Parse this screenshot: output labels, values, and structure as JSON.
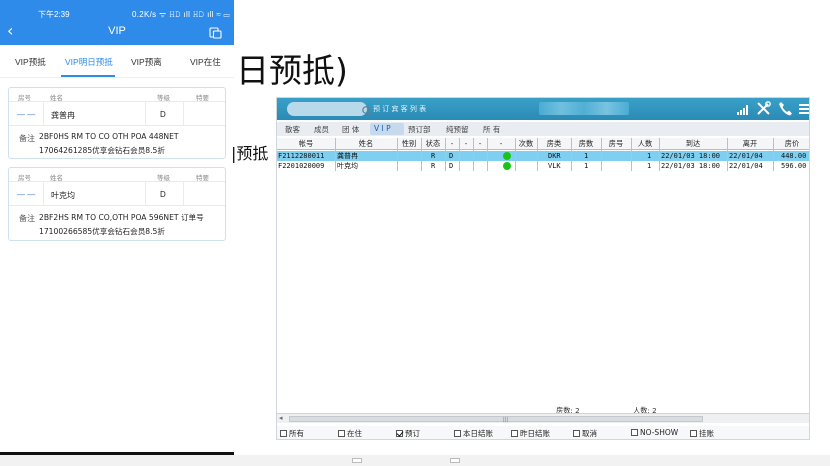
{
  "phone": {
    "status_time": "下午2:39",
    "status_right": "0.2K/s ᯤ 𝙷𝙳 ıll 𝙷𝙳 ıll ≈ ▭",
    "title": "VIP",
    "back_glyph": "‹",
    "tabs": [
      "VIP预抵",
      "VIP明日预抵",
      "VIP预离",
      "VIP在住"
    ],
    "active_tab": 1,
    "column_headers": {
      "room": "房号",
      "name": "姓名",
      "level": "等级",
      "special": "特要"
    },
    "note_label": "备注",
    "cards": [
      {
        "room": "—  —",
        "name": "龚普冉",
        "level": "D",
        "note_line1": "2BF0HS RM TO CO OTH POA 448NET",
        "note_line2": "17064261285优享会钻石会员8.5折"
      },
      {
        "room": "—  —",
        "name": "叶克均",
        "level": "D",
        "note_line1": "2BF2HS RM TO CO,OTH POA 596NET 订单号",
        "note_line2": "17100266585优享会钻石会员8.5折"
      }
    ]
  },
  "overlay": {
    "big_text": "日预抵)",
    "mid_text": "|预抵"
  },
  "window": {
    "caption": "预 订 宾 客 列 表",
    "filter_tabs": [
      "散客",
      "成员",
      "团 体",
      "V I P",
      "预订部",
      "纯预留",
      "所 有"
    ],
    "active_filter": 3,
    "columns": [
      "帐号",
      "姓名",
      "性别",
      "状态",
      "-",
      "-",
      "-",
      "-",
      "次数",
      "房类",
      "房数",
      "房号",
      "人数",
      "到达",
      "离开",
      "房价"
    ],
    "rows": [
      {
        "account": "F2112280011",
        "name": "龚普冉",
        "sex": "",
        "status": "R",
        "flag": "D",
        "count": "",
        "room_type": "DKR",
        "rooms": "1",
        "room_no": "",
        "persons": "1",
        "arrive": "22/01/03 18:00",
        "depart": "22/01/04",
        "rate": "448.00",
        "selected": true
      },
      {
        "account": "F2201020009",
        "name": "叶克均",
        "sex": "",
        "status": "R",
        "flag": "D",
        "count": "",
        "room_type": "VLK",
        "rooms": "1",
        "room_no": "",
        "persons": "1",
        "arrive": "22/01/03 18:00",
        "depart": "22/01/04",
        "rate": "596.00",
        "selected": false
      }
    ],
    "summary_rooms": "房数: 2",
    "summary_persons": "人数: 2",
    "checkboxes": [
      {
        "label": "所有",
        "checked": false
      },
      {
        "label": "在住",
        "checked": false
      },
      {
        "label": "预订",
        "checked": true
      },
      {
        "label": "本日结账",
        "checked": false
      },
      {
        "label": "昨日结账",
        "checked": false
      },
      {
        "label": "取消",
        "checked": false
      },
      {
        "label": "NO-SHOW",
        "checked": false
      },
      {
        "label": "挂账",
        "checked": false
      }
    ],
    "icons": [
      "search-icon",
      "signal-icon",
      "tools-icon",
      "phone-icon",
      "menu-icon"
    ],
    "colors": {
      "titlebar": "#2a8bb5",
      "selected_row": "#7fd0f0",
      "status_dot": "#18c418"
    }
  },
  "colors": {
    "phone_header": "#2f8bea",
    "active_tab": "#2f8bea"
  }
}
